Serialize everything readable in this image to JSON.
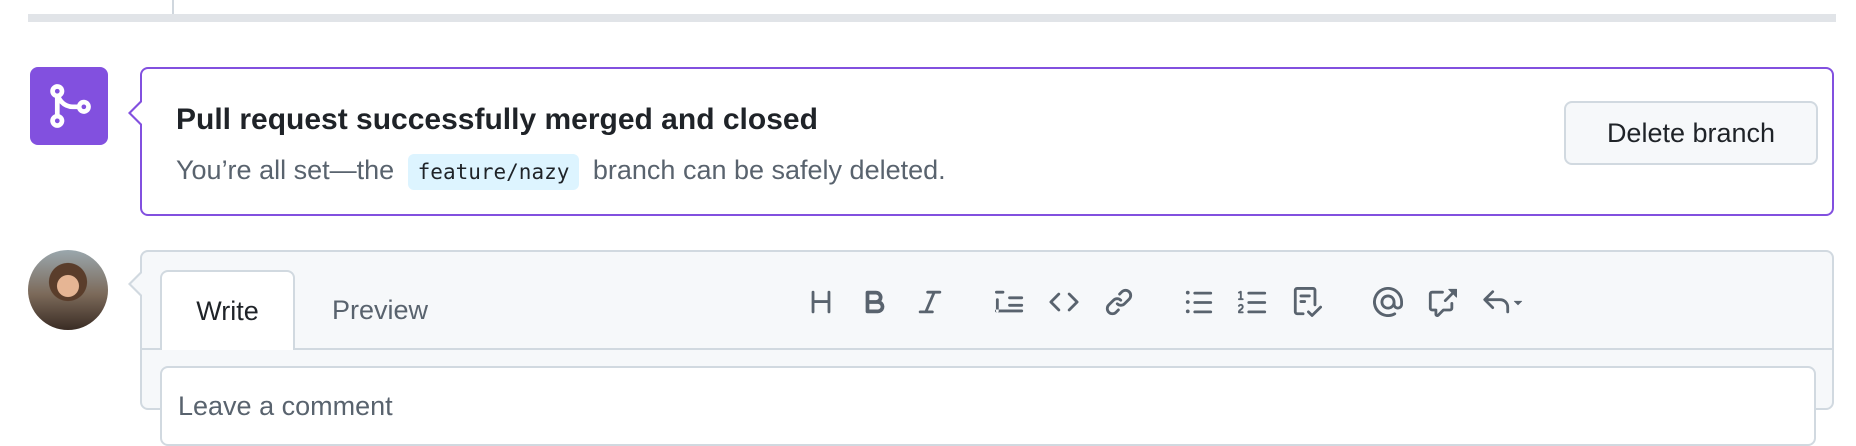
{
  "merge_status": {
    "title": "Pull request successfully merged and closed",
    "desc_prefix": "You’re all set—the",
    "branch": "feature/nazy",
    "desc_suffix": "branch can be safely deleted.",
    "delete_button": "Delete branch",
    "icon": "git-merge-icon",
    "accent": "#8250df"
  },
  "comment": {
    "tabs": [
      "Write",
      "Preview"
    ],
    "placeholder": "Leave a comment",
    "toolbar": [
      {
        "name": "heading",
        "icon": "heading-icon"
      },
      {
        "name": "bold",
        "icon": "bold-icon"
      },
      {
        "name": "italic",
        "icon": "italic-icon"
      },
      {
        "name": "quote",
        "icon": "quote-icon"
      },
      {
        "name": "code",
        "icon": "code-icon"
      },
      {
        "name": "link",
        "icon": "link-icon"
      },
      {
        "name": "unordered-list",
        "icon": "unordered-list-icon"
      },
      {
        "name": "ordered-list",
        "icon": "ordered-list-icon"
      },
      {
        "name": "task-list",
        "icon": "task-list-icon"
      },
      {
        "name": "mention",
        "icon": "mention-icon"
      },
      {
        "name": "cross-reference",
        "icon": "cross-reference-icon"
      },
      {
        "name": "saved-replies",
        "icon": "reply-icon"
      }
    ]
  }
}
